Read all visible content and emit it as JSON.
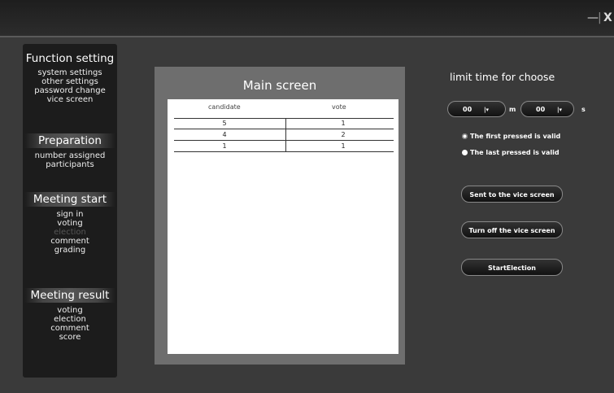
{
  "window": {
    "minimize": "—",
    "separator": "|",
    "close": "X"
  },
  "sidebar": {
    "function_setting": {
      "title": "Function setting",
      "items": [
        "system settings",
        "other settings",
        "password change",
        "vice screen"
      ]
    },
    "preparation": {
      "title": "Preparation",
      "items": [
        "number assigned",
        "participants"
      ]
    },
    "meeting_start": {
      "title": "Meeting start",
      "items": [
        "sign in",
        "voting",
        "election",
        "comment",
        "grading"
      ]
    },
    "meeting_result": {
      "title": "Meeting result",
      "items": [
        "voting",
        "election",
        "comment",
        "score"
      ]
    }
  },
  "main": {
    "title": "Main screen",
    "table": {
      "headers": [
        "candidate",
        "vote"
      ],
      "rows": [
        [
          "5",
          "1"
        ],
        [
          "4",
          "2"
        ],
        [
          "1",
          "1"
        ]
      ]
    }
  },
  "right": {
    "title": "limit time for choose",
    "minutes_value": "00",
    "minutes_unit": "m",
    "seconds_value": "00",
    "seconds_unit": "s",
    "dropdown_glyph": "|▾",
    "radio_first": "The first pressed is valid",
    "radio_last": "The last pressed is valid",
    "btn_send": "Sent to the vice screen",
    "btn_off": "Turn off the vice screen",
    "btn_start": "StartElection"
  }
}
